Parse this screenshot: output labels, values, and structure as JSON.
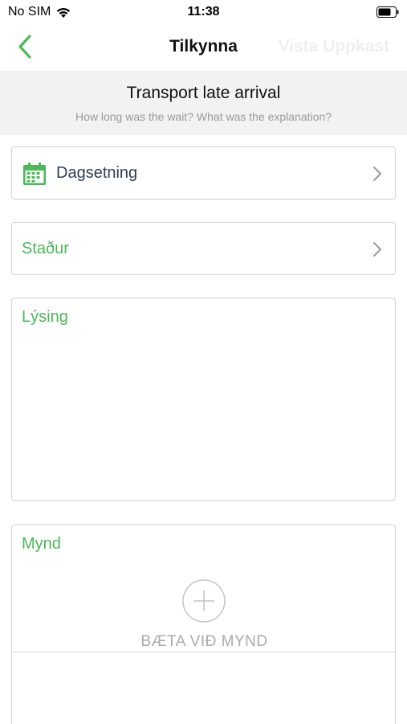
{
  "status_bar": {
    "carrier": "No SIM",
    "time": "11:38"
  },
  "nav": {
    "title": "Tilkynna",
    "save_draft_label": "Vista Uppkast"
  },
  "header": {
    "title": "Transport late arrival",
    "subtitle": "How long was the wait? What was the explanation?"
  },
  "form": {
    "date_label": "Dagsetning",
    "location_label": "Staður",
    "description_label": "Lýsing",
    "image_label": "Mynd",
    "add_image_label": "BÆTA VIÐ MYND"
  },
  "colors": {
    "accent_green": "#4cb857",
    "date_label_color": "#2f3e56",
    "save_draft_color": "#eef0ee"
  },
  "icons": {
    "back": "chevron-left-icon",
    "date": "calendar-icon",
    "row_disclosure": "chevron-right-icon",
    "add_image": "plus-circle-icon",
    "wifi": "wifi-icon",
    "battery": "battery-icon"
  }
}
